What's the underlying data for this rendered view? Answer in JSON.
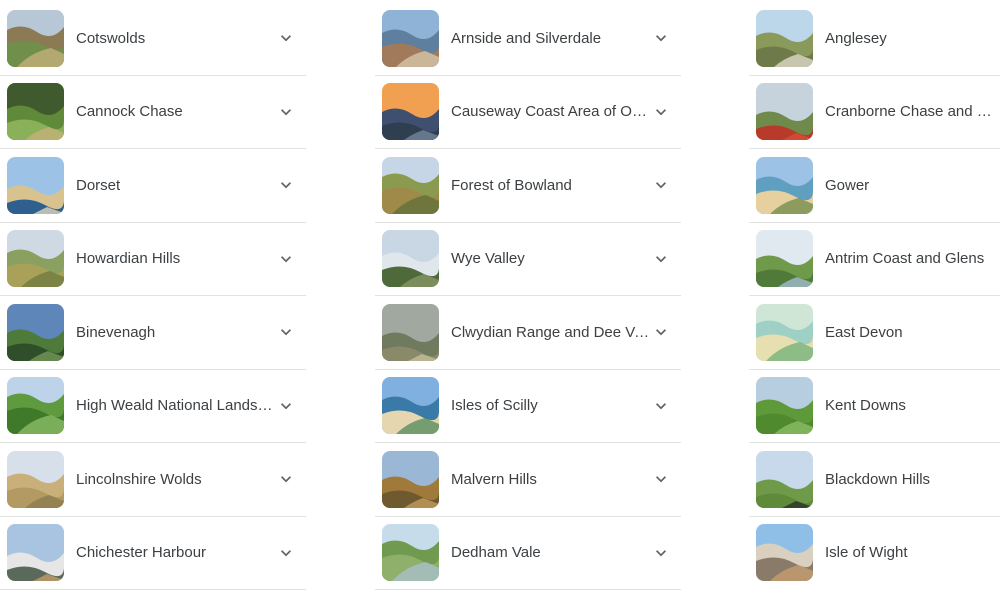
{
  "columns": [
    {
      "items": [
        {
          "label": "Cotswolds",
          "icon": "chevron-down-icon",
          "thumb": {
            "sky": "#b7c7d6",
            "mid": "#8c7a55",
            "ground": "#6f8f4a",
            "accent": "#c9b27d"
          }
        },
        {
          "label": "Cannock Chase",
          "icon": "chevron-down-icon",
          "thumb": {
            "sky": "#3f5a2c",
            "mid": "#5f8a3a",
            "ground": "#8bb05a",
            "accent": "#c7b27a"
          }
        },
        {
          "label": "Dorset",
          "icon": "chevron-down-icon",
          "thumb": {
            "sky": "#9cc3e6",
            "mid": "#d8c28f",
            "ground": "#2f5f8f",
            "accent": "#e8dcc0"
          }
        },
        {
          "label": "Howardian Hills",
          "icon": "chevron-down-icon",
          "thumb": {
            "sky": "#cfd9e3",
            "mid": "#8aa060",
            "ground": "#a9a05a",
            "accent": "#6f7a3f"
          }
        },
        {
          "label": "Binevenagh",
          "icon": "chevron-down-icon",
          "thumb": {
            "sky": "#5e86b8",
            "mid": "#4e7a3a",
            "ground": "#2f4f2a",
            "accent": "#7a9a5a"
          }
        },
        {
          "label": "High Weald National Landscape",
          "icon": "chevron-down-icon",
          "thumb": {
            "sky": "#bcd3ea",
            "mid": "#5f9a3f",
            "ground": "#3f7a2a",
            "accent": "#8fc06a"
          }
        },
        {
          "label": "Lincolnshire Wolds",
          "icon": "chevron-down-icon",
          "thumb": {
            "sky": "#d7e0ea",
            "mid": "#c9b07a",
            "ground": "#b39a62",
            "accent": "#8a7a4f"
          }
        },
        {
          "label": "Chichester Harbour",
          "icon": "chevron-down-icon",
          "thumb": {
            "sky": "#a9c4e0",
            "mid": "#e6e6e6",
            "ground": "#5a6a5a",
            "accent": "#c9a06a"
          }
        }
      ]
    },
    {
      "items": [
        {
          "label": "Arnside and Silverdale",
          "icon": "chevron-down-icon",
          "thumb": {
            "sky": "#8fb3d6",
            "mid": "#5f7f9f",
            "ground": "#a07a5a",
            "accent": "#d9cbb0"
          }
        },
        {
          "label": "Causeway Coast Area of Outstanding Natural Beauty",
          "icon": "chevron-down-icon",
          "thumb": {
            "sky": "#f0a050",
            "mid": "#3f4f6f",
            "ground": "#2f3f4f",
            "accent": "#7a8aa0"
          }
        },
        {
          "label": "Forest of Bowland",
          "icon": "chevron-down-icon",
          "thumb": {
            "sky": "#c7d6e6",
            "mid": "#8a9a4f",
            "ground": "#a08a4a",
            "accent": "#5f6f3a"
          }
        },
        {
          "label": "Wye Valley",
          "icon": "chevron-down-icon",
          "thumb": {
            "sky": "#c9d6e3",
            "mid": "#dfe6ec",
            "ground": "#4f6a3a",
            "accent": "#8a9a6a"
          }
        },
        {
          "label": "Clwydian Range and Dee Valley",
          "icon": "chevron-down-icon",
          "thumb": {
            "sky": "#a0a8a0",
            "mid": "#6f7a5f",
            "ground": "#8a8a6a",
            "accent": "#c9c0a0"
          }
        },
        {
          "label": "Isles of Scilly",
          "icon": "chevron-down-icon",
          "thumb": {
            "sky": "#7fb0e0",
            "mid": "#3a7aa8",
            "ground": "#e6d6b0",
            "accent": "#4f8a5a"
          }
        },
        {
          "label": "Malvern Hills",
          "icon": "chevron-down-icon",
          "thumb": {
            "sky": "#9ab8d6",
            "mid": "#a07a3a",
            "ground": "#6f5a2f",
            "accent": "#c9a060"
          }
        },
        {
          "label": "Dedham Vale",
          "icon": "chevron-down-icon",
          "thumb": {
            "sky": "#c7dcea",
            "mid": "#6f9a4f",
            "ground": "#8fb06a",
            "accent": "#a9c0d0"
          }
        }
      ]
    },
    {
      "items": [
        {
          "label": "Anglesey",
          "icon": "chevron-down-icon",
          "thumb": {
            "sky": "#bcd6ea",
            "mid": "#8a9a5a",
            "ground": "#6f7a4a",
            "accent": "#e6e0d0"
          }
        },
        {
          "label": "Cranborne Chase and West Wiltshire Downs",
          "icon": "chevron-down-icon",
          "thumb": {
            "sky": "#c7d3dc",
            "mid": "#6f8a4a",
            "ground": "#b83a2a",
            "accent": "#d9503a"
          }
        },
        {
          "label": "Gower",
          "icon": "chevron-down-icon",
          "thumb": {
            "sky": "#9cc3e6",
            "mid": "#5fa0c0",
            "ground": "#e6d0a0",
            "accent": "#6f8a4a"
          }
        },
        {
          "label": "Antrim Coast and Glens",
          "icon": "chevron-down-icon",
          "thumb": {
            "sky": "#e0e8f0",
            "mid": "#6f9a4a",
            "ground": "#4f7a3a",
            "accent": "#a9c0d6"
          }
        },
        {
          "label": "East Devon",
          "icon": "chevron-down-icon",
          "thumb": {
            "sky": "#cfe6d6",
            "mid": "#9fd0c6",
            "ground": "#e6e0b0",
            "accent": "#6fb07a"
          }
        },
        {
          "label": "Kent Downs",
          "icon": "chevron-down-icon",
          "thumb": {
            "sky": "#b7cde0",
            "mid": "#5f9a3a",
            "ground": "#4f8a2f",
            "accent": "#8fc06a"
          }
        },
        {
          "label": "Blackdown Hills",
          "icon": "chevron-down-icon",
          "thumb": {
            "sky": "#c7d9ea",
            "mid": "#6f9a4a",
            "ground": "#5f8a3a",
            "accent": "#2a2a2a"
          }
        },
        {
          "label": "Isle of Wight",
          "icon": "chevron-down-icon",
          "thumb": {
            "sky": "#8fbfe6",
            "mid": "#d9d0c0",
            "ground": "#8a7a6a",
            "accent": "#c9a070"
          }
        }
      ]
    }
  ]
}
